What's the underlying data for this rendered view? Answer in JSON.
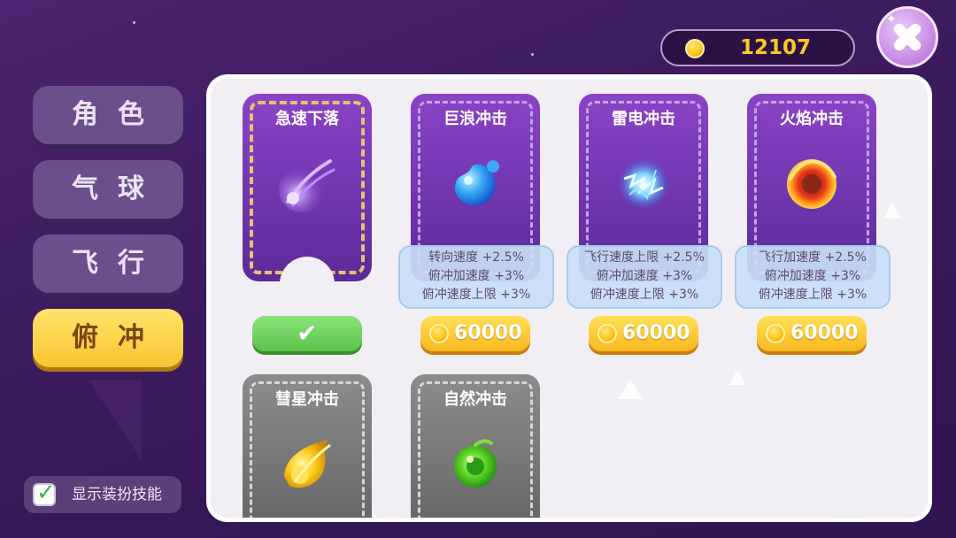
{
  "coins": {
    "amount": "12107",
    "icon": "coin-icon"
  },
  "close": {
    "icon": "close-icon"
  },
  "menu": [
    {
      "label": "角色",
      "active": false
    },
    {
      "label": "气球",
      "active": false
    },
    {
      "label": "飞行",
      "active": false
    },
    {
      "label": "俯冲",
      "active": true
    }
  ],
  "show_skill": {
    "label": "显示装扮技能",
    "checked": true
  },
  "skills": [
    {
      "title": "急速下落",
      "status": "equipped",
      "equip_mark": "✔",
      "icon": "meteor-purple-icon"
    },
    {
      "title": "巨浪冲击",
      "status": "purchasable",
      "price": "60000",
      "stats": [
        "转向速度 +2.5%",
        "俯冲加速度 +3%",
        "俯冲速度上限 +3%"
      ],
      "icon": "water-blob-icon"
    },
    {
      "title": "雷电冲击",
      "status": "purchasable",
      "price": "60000",
      "stats": [
        "飞行速度上限 +2.5%",
        "俯冲加速度 +3%",
        "俯冲速度上限 +3%"
      ],
      "icon": "lightning-ball-icon"
    },
    {
      "title": "火焰冲击",
      "status": "purchasable",
      "price": "60000",
      "stats": [
        "飞行加速度 +2.5%",
        "俯冲加速度 +3%",
        "俯冲速度上限 +3%"
      ],
      "icon": "fire-ring-icon"
    },
    {
      "title": "彗星冲击",
      "status": "locked",
      "icon": "comet-gold-icon"
    },
    {
      "title": "自然冲击",
      "status": "locked",
      "icon": "nature-swirl-icon"
    }
  ],
  "colors": {
    "accent": "#ffc827",
    "panel": "#f1eef4",
    "card_purple": "#7a3bb8"
  }
}
